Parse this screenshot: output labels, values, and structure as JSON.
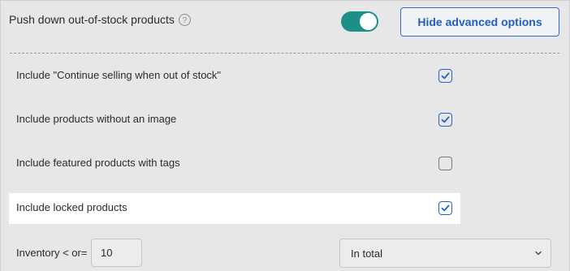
{
  "header": {
    "label": "Push down out-of-stock products",
    "help_icon": "question-mark-circle",
    "help_glyph": "?",
    "toggle_on": true,
    "advanced_button_label": "Hide advanced options"
  },
  "options": [
    {
      "label": "Include \"Continue selling when out of stock\"",
      "checked": true,
      "highlighted": false
    },
    {
      "label": "Include products without an image",
      "checked": true,
      "highlighted": false
    },
    {
      "label": "Include featured products with tags",
      "checked": false,
      "highlighted": false
    },
    {
      "label": "Include locked products",
      "checked": true,
      "highlighted": true
    }
  ],
  "inventory": {
    "label": "Inventory < or=",
    "value": "10",
    "scope_selected": "In total"
  },
  "colors": {
    "accent": "#1c8f86",
    "button_blue": "#2f6fd0",
    "check_blue": "#2563c9"
  }
}
